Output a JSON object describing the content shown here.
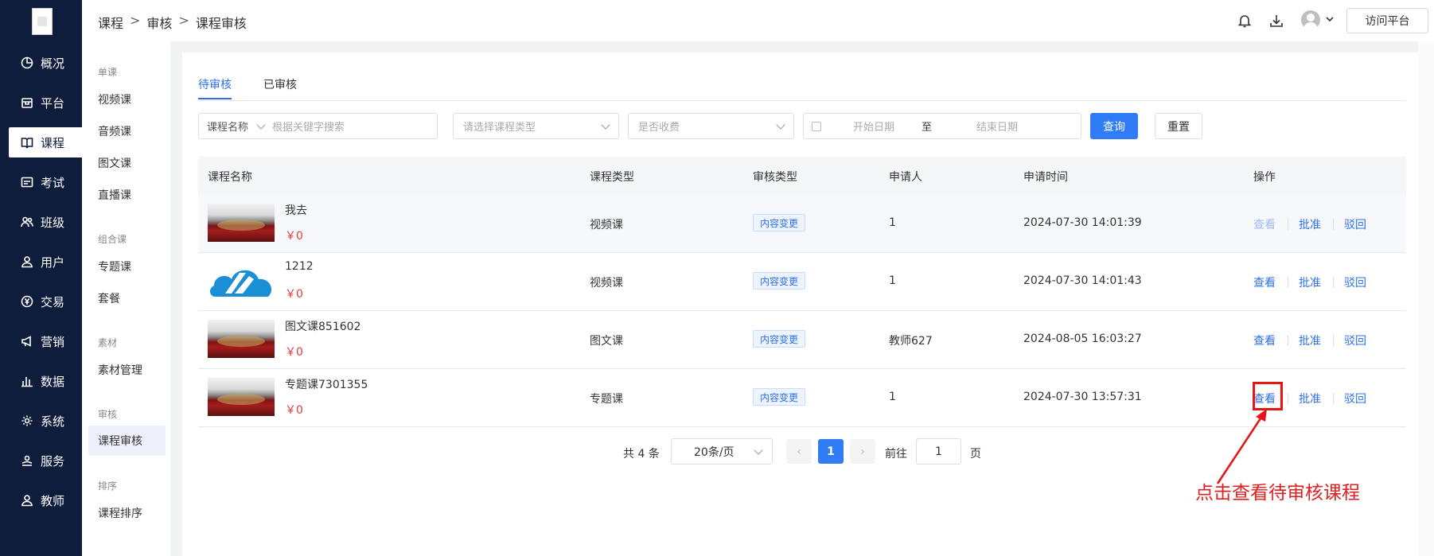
{
  "rail": {
    "items": [
      {
        "label": "概况",
        "icon": "pie-chart-icon"
      },
      {
        "label": "平台",
        "icon": "store-icon"
      },
      {
        "label": "课程",
        "icon": "book-icon",
        "active": true
      },
      {
        "label": "考试",
        "icon": "exam-icon"
      },
      {
        "label": "班级",
        "icon": "class-icon"
      },
      {
        "label": "用户",
        "icon": "user-icon"
      },
      {
        "label": "交易",
        "icon": "yen-icon"
      },
      {
        "label": "营销",
        "icon": "megaphone-icon"
      },
      {
        "label": "数据",
        "icon": "bar-chart-icon"
      },
      {
        "label": "系统",
        "icon": "gear-icon"
      },
      {
        "label": "服务",
        "icon": "service-icon"
      },
      {
        "label": "教师",
        "icon": "teacher-icon"
      }
    ]
  },
  "subnav": {
    "groups": [
      {
        "title": "单课",
        "items": [
          "视频课",
          "音频课",
          "图文课",
          "直播课"
        ]
      },
      {
        "title": "组合课",
        "items": [
          "专题课",
          "套餐"
        ]
      },
      {
        "title": "素材",
        "items": [
          "素材管理"
        ]
      },
      {
        "title": "审核",
        "items": [
          "课程审核"
        ]
      },
      {
        "title": "排序",
        "items": [
          "课程排序"
        ]
      }
    ]
  },
  "header": {
    "breadcrumb": [
      "课程",
      "审核",
      "课程审核"
    ],
    "visit_button": "访问平台"
  },
  "tabs": [
    "待审核",
    "已审核"
  ],
  "filters": {
    "name_select": "课程名称",
    "keyword_placeholder": "根据关键字搜索",
    "type_placeholder": "请选择课程类型",
    "fee_placeholder": "是否收费",
    "start_placeholder": "开始日期",
    "range_sep": "至",
    "end_placeholder": "结束日期",
    "search_button": "查询",
    "reset_button": "重置"
  },
  "table": {
    "columns": [
      "课程名称",
      "课程类型",
      "审核类型",
      "申请人",
      "申请时间",
      "操作"
    ],
    "rows": [
      {
        "name": "我去",
        "price": "￥0",
        "type": "视频课",
        "audit_type": "内容变更",
        "applicant": "1",
        "time": "2024-07-30 14:01:39",
        "thumb": "photo"
      },
      {
        "name": "1212",
        "price": "￥0",
        "type": "视频课",
        "audit_type": "内容变更",
        "applicant": "1",
        "time": "2024-07-30 14:01:43",
        "thumb": "logo"
      },
      {
        "name": "图文课851602",
        "price": "￥0",
        "type": "图文课",
        "audit_type": "内容变更",
        "applicant": "教师627",
        "time": "2024-08-05 16:03:27",
        "thumb": "photo"
      },
      {
        "name": "专题课7301355",
        "price": "￥0",
        "type": "专题课",
        "audit_type": "内容变更",
        "applicant": "1",
        "time": "2024-07-30 13:57:31",
        "thumb": "photo"
      }
    ],
    "actions": {
      "view": "查看",
      "approve": "批准",
      "reject": "驳回"
    }
  },
  "pagination": {
    "total": "共 4 条",
    "page_size": "20条/页",
    "current_page": "1",
    "goto_label": "前往",
    "goto_value": "1",
    "page_suffix": "页"
  },
  "annotation": {
    "text": "点击查看待审核课程",
    "color": "#e02020"
  },
  "colors": {
    "rail_bg": "#0f1d3d",
    "primary": "#2f7cf6",
    "price": "#e23c3c"
  }
}
